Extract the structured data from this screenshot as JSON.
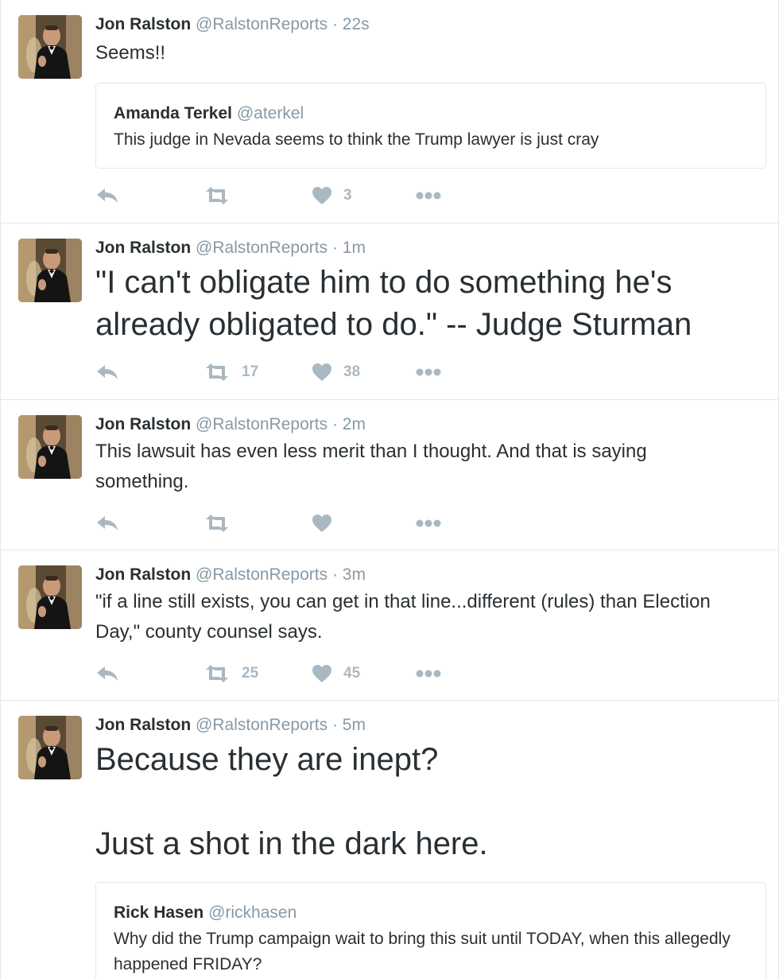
{
  "tweets": [
    {
      "name": "Jon Ralston",
      "handle": "@RalstonReports",
      "sep": "·",
      "time": "22s",
      "text": "Seems!!",
      "quote": {
        "name": "Amanda Terkel",
        "handle": "@aterkel",
        "text": "This judge in Nevada seems to think the Trump lawyer is just cray"
      },
      "retweets": "",
      "likes": "3"
    },
    {
      "name": "Jon Ralston",
      "handle": "@RalstonReports",
      "sep": "·",
      "time": "1m",
      "text": "\"I can't obligate him to do something he's already obligated to do.\" -- Judge Sturman",
      "retweets": "17",
      "likes": "38"
    },
    {
      "name": "Jon Ralston",
      "handle": "@RalstonReports",
      "sep": "·",
      "time": "2m",
      "text": "This lawsuit has even less merit than I thought. And that is saying something.",
      "retweets": "",
      "likes": ""
    },
    {
      "name": "Jon Ralston",
      "handle": "@RalstonReports",
      "sep": "·",
      "time": "3m",
      "text": "\"if a line still exists, you can get in that line...different (rules) than Election Day,\" county counsel says.",
      "retweets": "25",
      "likes": "45"
    },
    {
      "name": "Jon Ralston",
      "handle": "@RalstonReports",
      "sep": "·",
      "time": "5m",
      "text": "Because they are inept?\n\nJust a shot in the dark here.",
      "quote": {
        "name": "Rick Hasen",
        "handle": "@rickhasen",
        "text": "Why did the Trump campaign wait to bring this suit until TODAY, when this allegedly happened FRIDAY?"
      }
    }
  ],
  "colors": {
    "text": "#292f33",
    "muted": "#8899a6",
    "icon": "#aab8c2",
    "border": "#e1e8ed"
  },
  "icons": {
    "reply": "reply-icon",
    "retweet": "retweet-icon",
    "like": "heart-icon",
    "more": "more-dots-icon"
  }
}
